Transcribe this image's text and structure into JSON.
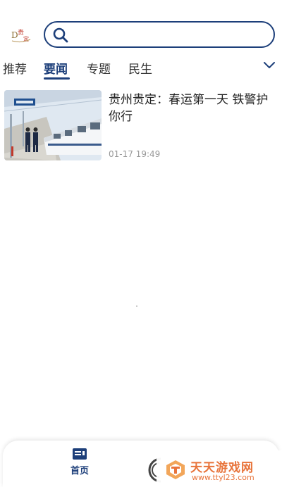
{
  "header": {
    "logo_alt": "贵定",
    "search": {
      "placeholder": "",
      "value": ""
    }
  },
  "tabs": [
    {
      "label": "推荐",
      "active": false
    },
    {
      "label": "要闻",
      "active": true
    },
    {
      "label": "专题",
      "active": false
    },
    {
      "label": "民生",
      "active": false
    }
  ],
  "articles": [
    {
      "title": "贵州贵定：春运第一天 铁警护你行",
      "time": "01-17 19:49"
    }
  ],
  "bottom_nav": {
    "home_label": "首页"
  },
  "watermark": {
    "name": "天天游戏网",
    "url": "www.ttyl23.com"
  },
  "colors": {
    "accent": "#1d3f7a",
    "muted": "#999999",
    "watermark": "#e8743b"
  },
  "icons": [
    "app-logo-icon",
    "search-icon",
    "chevron-down-icon",
    "home-icon",
    "news-photo",
    "watermark-logo-icon"
  ]
}
